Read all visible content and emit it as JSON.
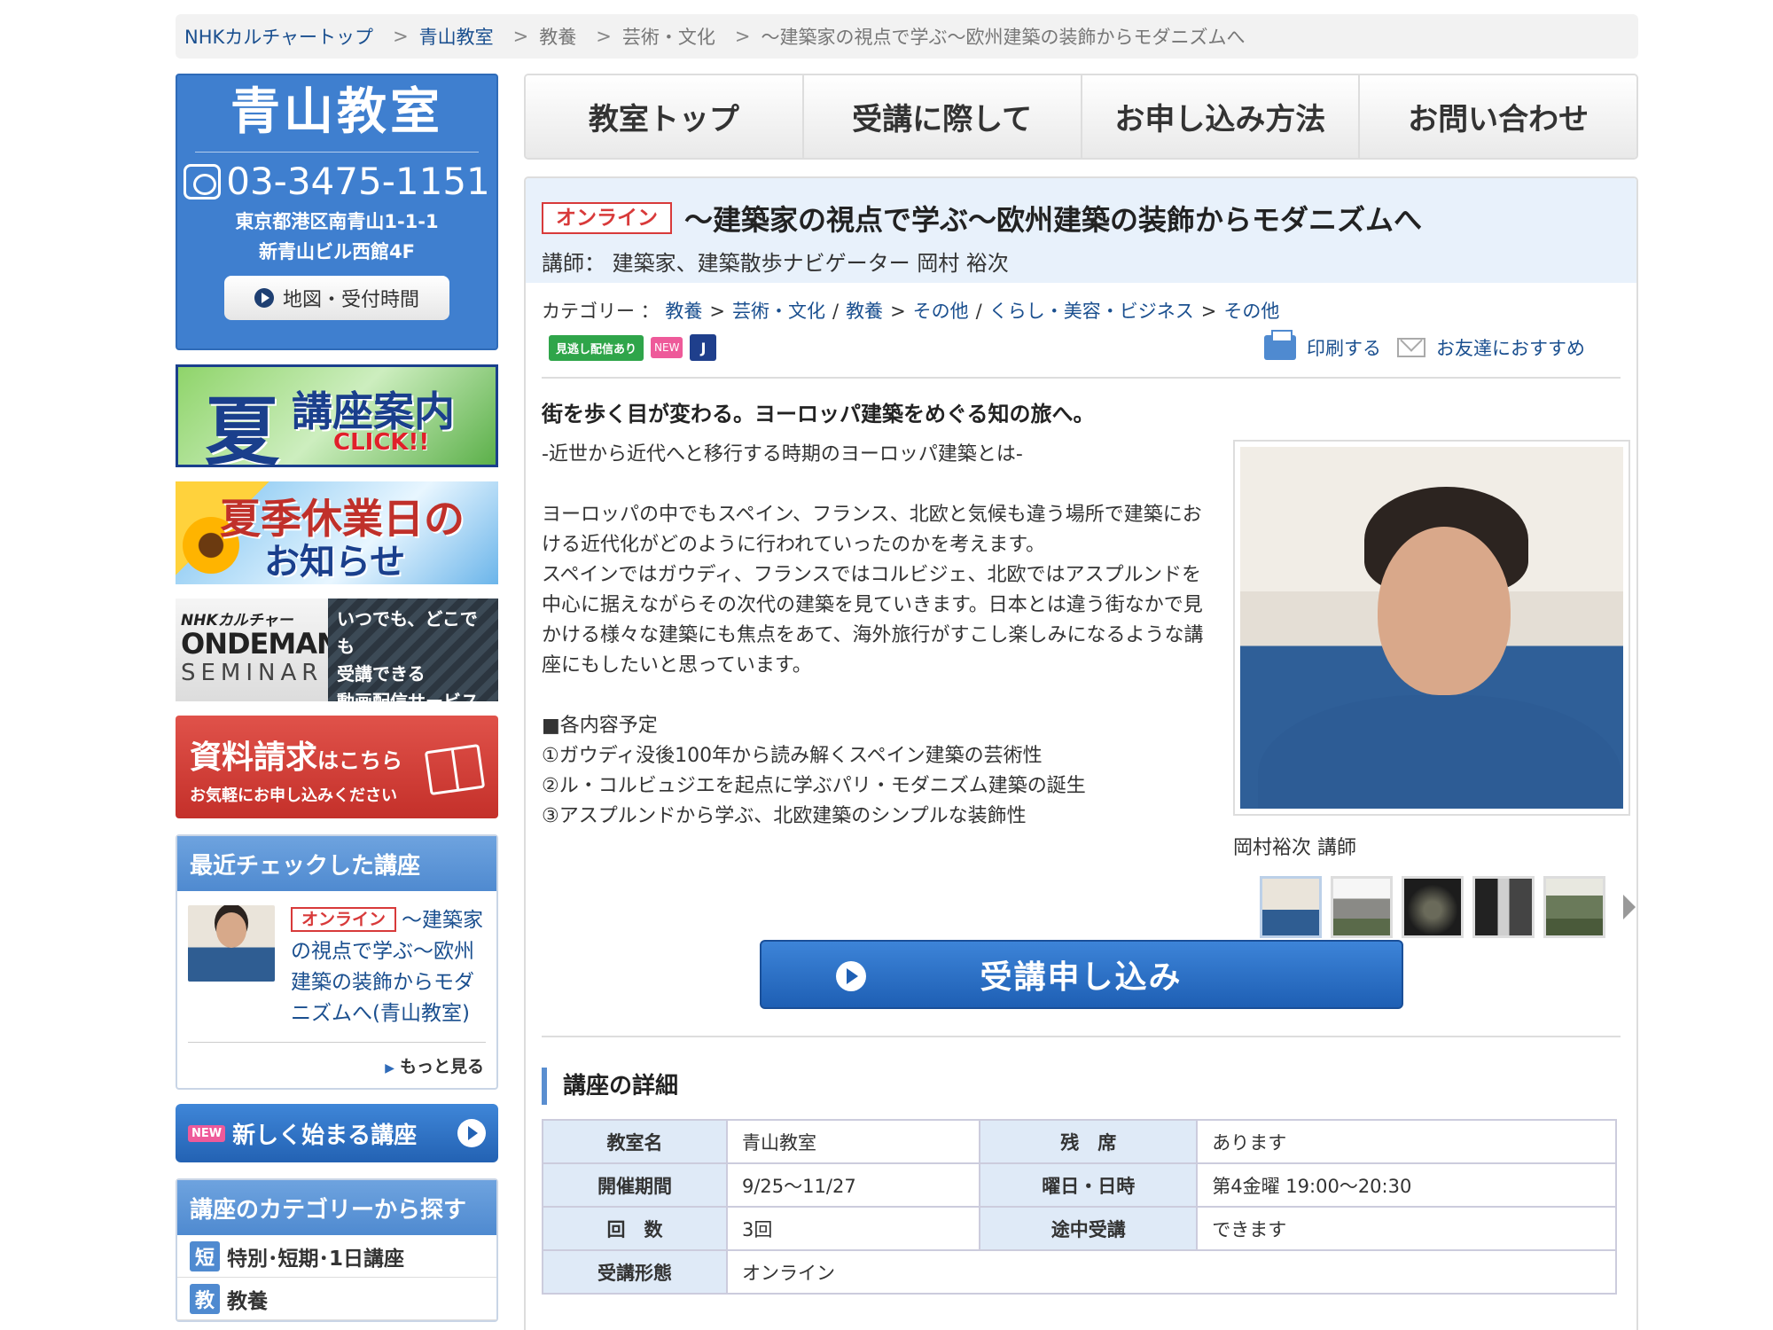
{
  "breadcrumb": [
    {
      "label": "NHKカルチャートップ",
      "link": true
    },
    {
      "label": "青山教室",
      "link": true
    },
    {
      "label": "教養",
      "link": false
    },
    {
      "label": "芸術・文化",
      "link": false
    },
    {
      "label": "〜建築家の視点で学ぶ〜欧州建築の装飾からモダニズムへ",
      "link": false
    }
  ],
  "breadcrumb_sep": ">",
  "school": {
    "name": "青山教室",
    "phone": "03-3475-1151",
    "address1": "東京都港区南青山1-1-1",
    "address2": "新青山ビル西館4F",
    "map_button": "地図・受付時間"
  },
  "banners": {
    "summer": {
      "kanji": "夏",
      "title": "講座案内",
      "click": "CLICK!!"
    },
    "holiday": {
      "line1": "夏季休業日の",
      "line2": "お知らせ"
    },
    "ondemand": {
      "brand": "NHKカルチャー",
      "big": "ONDEMAND",
      "seminar": "SEMINAR",
      "line1": "いつでも、どこでも",
      "line2": "受講できる",
      "line3": "動画配信サービス"
    },
    "request": {
      "title": "資料請求",
      "title_small": "はこちら",
      "sub": "お気軽にお申し込みください"
    }
  },
  "recent": {
    "title": "最近チェックした講座",
    "badge": "オンライン",
    "item_text": "〜建築家の視点で学ぶ〜欧州建築の装飾からモダニズムへ(青山教室)",
    "more": "もっと見る"
  },
  "new_courses": {
    "tag": "NEW",
    "label": "新しく始まる講座"
  },
  "category_panel": {
    "title": "講座のカテゴリーから探す",
    "items": [
      {
        "icon": "短",
        "label": "特別･短期･1日講座"
      },
      {
        "icon": "教",
        "label": "教養"
      }
    ]
  },
  "nav": [
    "教室トップ",
    "受講に際して",
    "お申し込み方法",
    "お問い合わせ"
  ],
  "course": {
    "badge": "オンライン",
    "title": "〜建築家の視点で学ぶ〜欧州建築の装飾からモダニズムへ",
    "teacher": "講師： 建築家、建築散歩ナビゲーター 岡村 裕次",
    "category_label": "カテゴリー ：",
    "categories": [
      {
        "a": "教養",
        "b": "芸術・文化"
      },
      {
        "a": "教養",
        "b": "その他"
      },
      {
        "a": "くらし・美容・ビジネス",
        "b": "その他"
      }
    ],
    "tags": {
      "green": "見逃し配信あり",
      "new": "NEW",
      "blue": "J"
    },
    "print": "印刷する",
    "recommend": "お友達におすすめ",
    "lead": "街を歩く目が変わる。ヨーロッパ建築をめぐる知の旅へ。",
    "description": [
      "-近世から近代へと移行する時期のヨーロッパ建築とは-",
      "",
      "ヨーロッパの中でもスペイン、フランス、北欧と気候も違う場所で建築における近代化がどのように行われていったのかを考えます。",
      "スペインではガウディ、フランスではコルビジェ、北欧ではアスプルンドを中心に据えながらその次代の建築を見ていきます。日本とは違う街なかで見かける様々な建築にも焦点をあて、海外旅行がすこし楽しみになるような講座にもしたいと思っています。",
      "",
      "■各内容予定",
      "①ガウディ没後100年から読み解くスペイン建築の芸術性",
      "②ル・コルビュジエを起点に学ぶパリ・モダニズム建築の誕生",
      "③アスプルンドから学ぶ、北欧建築のシンプルな装飾性"
    ],
    "photo_caption": "岡村裕次 講師",
    "apply_button": "受講申し込み",
    "details_title": "講座の詳細",
    "details": [
      {
        "k1": "教室名",
        "v1": "青山教室",
        "k2": "残　席",
        "v2": "あります"
      },
      {
        "k1": "開催期間",
        "v1": "9/25〜11/27",
        "k2": "曜日・日時",
        "v2": "第4金曜 19:00〜20:30"
      },
      {
        "k1": "回　数",
        "v1": "3回",
        "k2": "途中受講",
        "v2": "できます"
      },
      {
        "k1": "受講形態",
        "v1": "オンライン",
        "k2": "",
        "v2": ""
      }
    ]
  },
  "colors": {
    "accent_blue": "#3f7fcf",
    "link": "#1a4f8f",
    "badge_red": "#d83a3a",
    "apply_blue": "#1e5fb4"
  }
}
